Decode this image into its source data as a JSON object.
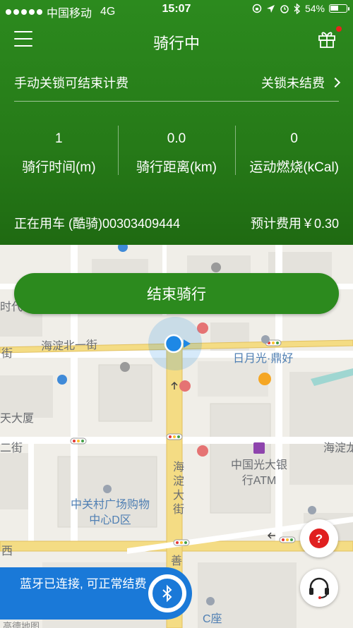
{
  "status_bar": {
    "carrier": "中国移动",
    "network": "4G",
    "time": "15:07",
    "battery_text": "54%",
    "battery_level": 0.54
  },
  "nav": {
    "title": "骑行中"
  },
  "lock_info": {
    "left": "手动关锁可结束计费",
    "right": "关锁未结费"
  },
  "stats": [
    {
      "value": "1",
      "label": "骑行时间(m)"
    },
    {
      "value": "0.0",
      "label": "骑行距离(km)"
    },
    {
      "value": "0",
      "label": "运动燃烧(kCal)"
    }
  ],
  "bike": {
    "using_text": "正在用车 (酷骑)00303409444",
    "fee_text": "预计费用￥0.30"
  },
  "end_button": {
    "label": "结束骑行"
  },
  "bluetooth": {
    "text": "蓝牙已连接, 可正常结费"
  },
  "map_labels": {
    "haidian_north_1st": "海淀北一街",
    "riyueguang": "日月光·鼎好",
    "tian_dasha": "天大厦",
    "er_jie": "二街",
    "haidian_ave": "海淀大街",
    "everbright": "中国光大银行ATM",
    "zhongguancun": "中关村广场购物中心D区",
    "haidian_long": "海淀龙",
    "shi_dai": "时代",
    "jie": "街",
    "c_zuo": "C座",
    "shan": "善",
    "xi": "西",
    "map_credit": "高德地图"
  },
  "colors": {
    "header_green": "#267a18",
    "button_green": "#2c8a1e",
    "bluetooth_blue": "#1a79d8",
    "road_yellow": "#f2d675",
    "location_blue": "#1e88e5"
  }
}
